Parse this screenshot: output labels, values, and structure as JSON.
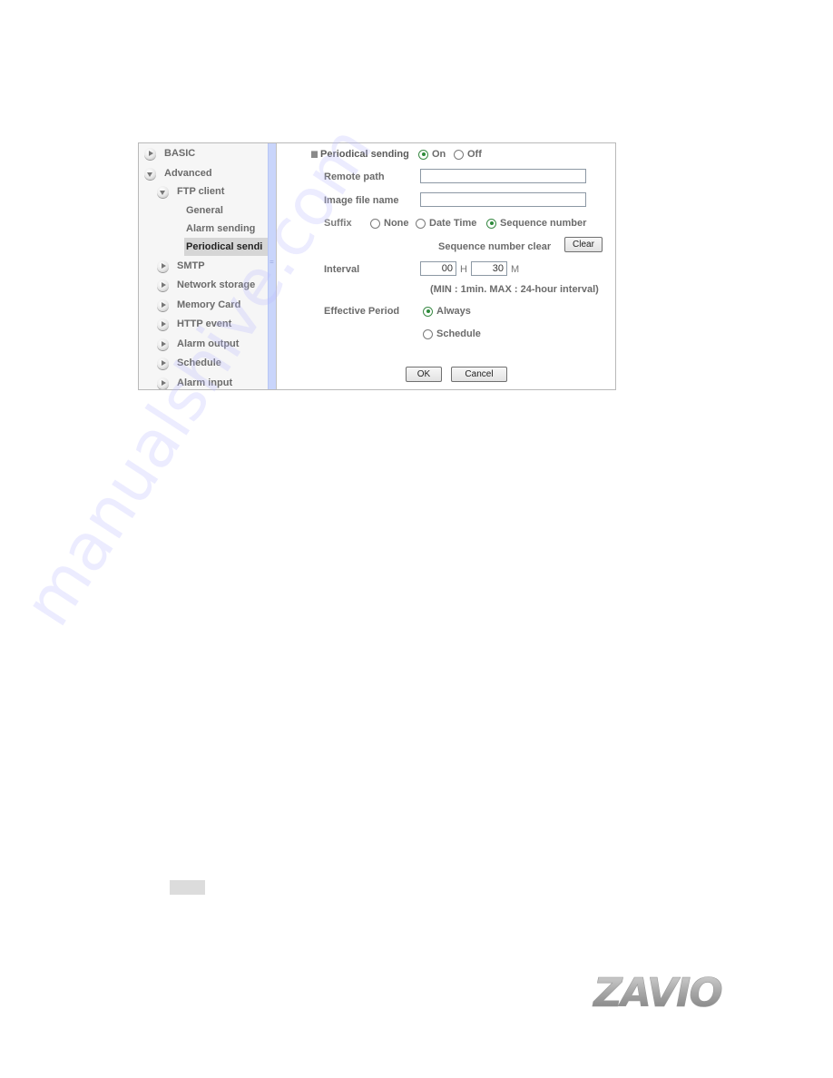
{
  "sidebar": {
    "items": [
      {
        "label": "BASIC",
        "icon": "arrow-right-icon",
        "level": 0
      },
      {
        "label": "Advanced",
        "icon": "arrow-down-icon",
        "level": 0
      },
      {
        "label": "FTP client",
        "icon": "arrow-down-icon",
        "level": 1
      },
      {
        "label": "General",
        "level": 2
      },
      {
        "label": "Alarm sending",
        "level": 2
      },
      {
        "label": "Periodical sendi",
        "level": 2,
        "active": true
      },
      {
        "label": "SMTP",
        "icon": "arrow-right-icon",
        "level": 1
      },
      {
        "label": "Network storage",
        "icon": "arrow-right-icon",
        "level": 1
      },
      {
        "label": "Memory Card",
        "icon": "arrow-right-icon",
        "level": 1
      },
      {
        "label": "HTTP event",
        "icon": "arrow-right-icon",
        "level": 1
      },
      {
        "label": "Alarm output",
        "icon": "arrow-right-icon",
        "level": 1
      },
      {
        "label": "Schedule",
        "icon": "arrow-right-icon",
        "level": 1
      },
      {
        "label": "Alarm input",
        "icon": "arrow-right-icon",
        "level": 1
      }
    ]
  },
  "form": {
    "periodical_sending": {
      "label": "Periodical sending",
      "on_label": "On",
      "off_label": "Off",
      "selected": "On"
    },
    "remote_path": {
      "label": "Remote path",
      "value": ""
    },
    "image_file_name": {
      "label": "Image file name",
      "value": ""
    },
    "suffix": {
      "label": "Suffix",
      "options": [
        "None",
        "Date Time",
        "Sequence number"
      ],
      "selected": "Sequence number"
    },
    "sequence_clear": {
      "label": "Sequence number clear",
      "button": "Clear"
    },
    "interval": {
      "label": "Interval",
      "hours": "00",
      "hours_unit": "H",
      "minutes": "30",
      "minutes_unit": "M",
      "hint": "(MIN : 1min. MAX : 24-hour interval)"
    },
    "effective_period": {
      "label": "Effective Period",
      "options": [
        "Always",
        "Schedule"
      ],
      "selected": "Always"
    },
    "ok_button": "OK",
    "cancel_button": "Cancel"
  },
  "logo": {
    "text": "ZAVIO"
  },
  "watermark": {
    "text": "manualshive.com"
  },
  "colors": {
    "accent_radio": "#2e8b3a",
    "splitter": "#c9d5fb"
  }
}
